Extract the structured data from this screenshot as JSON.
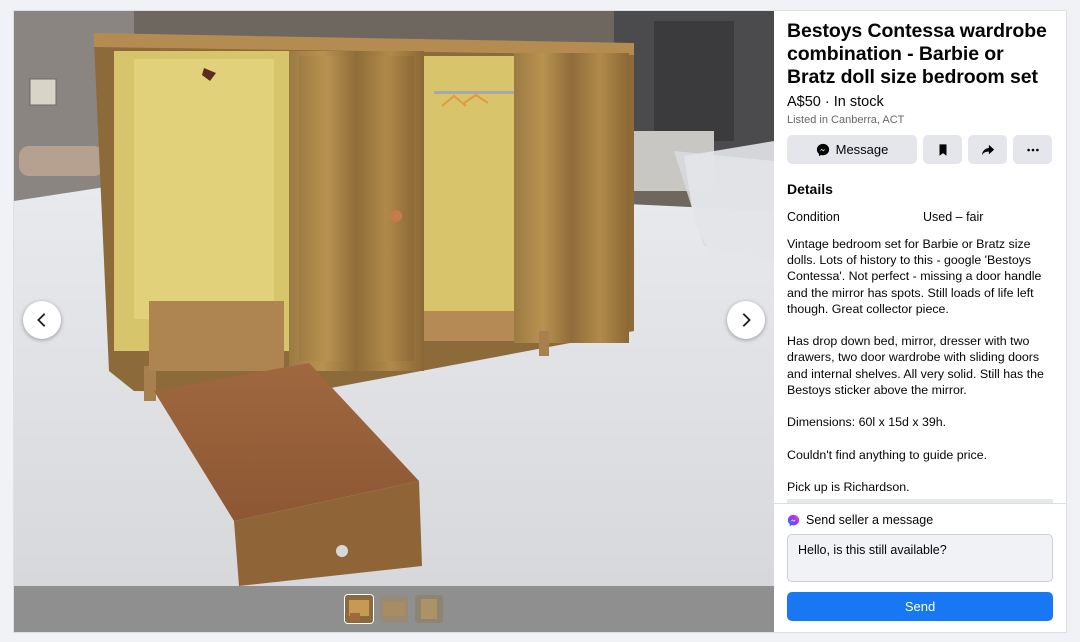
{
  "listing": {
    "title": "Bestoys Contessa wardrobe combination - Barbie or Bratz doll size bedroom set",
    "price_status": "A$50 · In stock",
    "location": "Listed in Canberra, ACT"
  },
  "actions": {
    "message_label": "Message",
    "message_icon": "messenger-icon",
    "save_icon": "bookmark-icon",
    "share_icon": "share-icon",
    "more_icon": "more-icon"
  },
  "details": {
    "heading": "Details",
    "condition_key": "Condition",
    "condition_value": "Used – fair",
    "description": "Vintage bedroom set for Barbie or Bratz size dolls. Lots of history to this - google 'Bestoys Contessa'. Not perfect - missing a door handle and the mirror has spots. Still loads of life left though. Great collector piece.\n\nHas drop down bed, mirror, dresser with two drawers, two door wardrobe with sliding doors and internal shelves. All very solid. Still has the Bestoys sticker above the mirror.\n\nDimensions: 60l x 15d x 39h.\n\nCouldn't find anything to guide price.\n\nPick up is Richardson."
  },
  "compose": {
    "heading": "Send seller a message",
    "message_value": "Hello, is this still available?",
    "send_label": "Send"
  },
  "gallery": {
    "thumbnail_count": 3,
    "active_index": 0
  },
  "colors": {
    "accent": "#1877f2",
    "button_bg": "#e4e6eb",
    "page_bg": "#f0f2f5"
  }
}
